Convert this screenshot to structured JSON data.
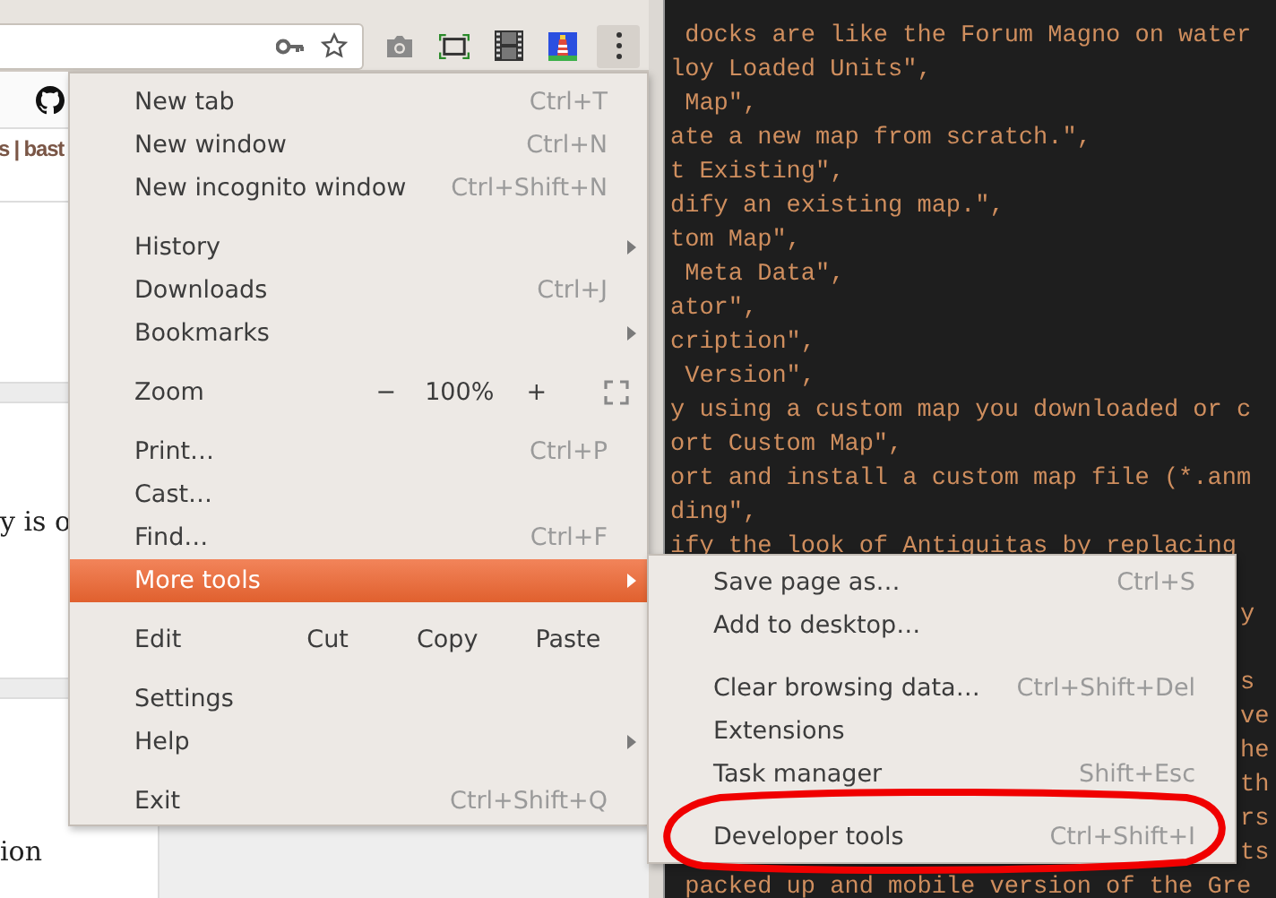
{
  "page": {
    "nav_text": "s | bast",
    "body_text": "y is o",
    "bottom_text": "ion"
  },
  "menu": {
    "items": [
      {
        "kind": "item",
        "label": "New tab",
        "shortcut": "Ctrl+T",
        "submenu": false,
        "selected": false
      },
      {
        "kind": "item",
        "label": "New window",
        "shortcut": "Ctrl+N",
        "submenu": false,
        "selected": false
      },
      {
        "kind": "item",
        "label": "New incognito window",
        "shortcut": "Ctrl+Shift+N",
        "submenu": false,
        "selected": false
      },
      {
        "kind": "separator"
      },
      {
        "kind": "item",
        "label": "History",
        "submenu": true,
        "selected": false
      },
      {
        "kind": "item",
        "label": "Downloads",
        "shortcut": "Ctrl+J",
        "submenu": false,
        "selected": false
      },
      {
        "kind": "item",
        "label": "Bookmarks",
        "submenu": true,
        "selected": false
      },
      {
        "kind": "separator"
      },
      {
        "kind": "zoom",
        "label": "Zoom",
        "minus": "−",
        "value": "100%",
        "plus": "+"
      },
      {
        "kind": "separator"
      },
      {
        "kind": "item",
        "label": "Print…",
        "shortcut": "Ctrl+P",
        "submenu": false,
        "selected": false
      },
      {
        "kind": "item",
        "label": "Cast…",
        "submenu": false,
        "selected": false
      },
      {
        "kind": "item",
        "label": "Find…",
        "shortcut": "Ctrl+F",
        "submenu": false,
        "selected": false
      },
      {
        "kind": "item",
        "label": "More tools",
        "submenu": true,
        "selected": true
      },
      {
        "kind": "separator"
      },
      {
        "kind": "edit",
        "label": "Edit",
        "actions": [
          "Cut",
          "Copy",
          "Paste"
        ]
      },
      {
        "kind": "separator"
      },
      {
        "kind": "item",
        "label": "Settings",
        "submenu": false,
        "selected": false
      },
      {
        "kind": "item",
        "label": "Help",
        "submenu": true,
        "selected": false
      },
      {
        "kind": "separator"
      },
      {
        "kind": "item",
        "label": "Exit",
        "shortcut": "Ctrl+Shift+Q",
        "submenu": false,
        "selected": false
      }
    ]
  },
  "submenu": {
    "items": [
      {
        "kind": "item",
        "label": "Save page as…",
        "shortcut": "Ctrl+S",
        "selected": false
      },
      {
        "kind": "item",
        "label": "Add to desktop…",
        "selected": false
      },
      {
        "kind": "separator"
      },
      {
        "kind": "item",
        "label": "Clear browsing data…",
        "shortcut": "Ctrl+Shift+Del",
        "selected": false
      },
      {
        "kind": "item",
        "label": "Extensions",
        "selected": false
      },
      {
        "kind": "item",
        "label": "Task manager",
        "shortcut": "Shift+Esc",
        "selected": false
      },
      {
        "kind": "separator"
      },
      {
        "kind": "item",
        "label": "Developer tools",
        "shortcut": "Ctrl+Shift+I",
        "selected": false
      }
    ]
  },
  "editor": {
    "lines": [
      {
        "kind": "hidden"
      },
      {
        "kind": "full",
        "text": " docks are like the Forum Magno on water"
      },
      {
        "kind": "full",
        "text": "loy Loaded Units\","
      },
      {
        "kind": "full",
        "text": " Map\","
      },
      {
        "kind": "full",
        "text": "ate a new map from scratch.\","
      },
      {
        "kind": "full",
        "text": "t Existing\","
      },
      {
        "kind": "full",
        "text": "dify an existing map.\","
      },
      {
        "kind": "full",
        "text": "tom Map\","
      },
      {
        "kind": "full",
        "text": " Meta Data\","
      },
      {
        "kind": "full",
        "text": "ator\","
      },
      {
        "kind": "full",
        "text": "cription\","
      },
      {
        "kind": "full",
        "text": " Version\","
      },
      {
        "kind": "full",
        "text": "y using a custom map you downloaded or c"
      },
      {
        "kind": "full",
        "text": "ort Custom Map\","
      },
      {
        "kind": "full",
        "text": "ort and install a custom map file (*.anm"
      },
      {
        "kind": "full",
        "text": "ding\","
      },
      {
        "kind": "full",
        "text": "ify the look of Antiguitas by replacing"
      },
      {
        "kind": "hidden"
      },
      {
        "kind": "tail",
        "text": "y"
      },
      {
        "kind": "hidden"
      },
      {
        "kind": "tail",
        "text": "s"
      },
      {
        "kind": "tail",
        "text": "ve"
      },
      {
        "kind": "tail",
        "text": "he"
      },
      {
        "kind": "tail",
        "text": "th"
      },
      {
        "kind": "tail",
        "text": "rs"
      },
      {
        "kind": "tail",
        "text": "ts"
      },
      {
        "kind": "full",
        "text": " packed up and mobile version of the Gre"
      }
    ]
  }
}
